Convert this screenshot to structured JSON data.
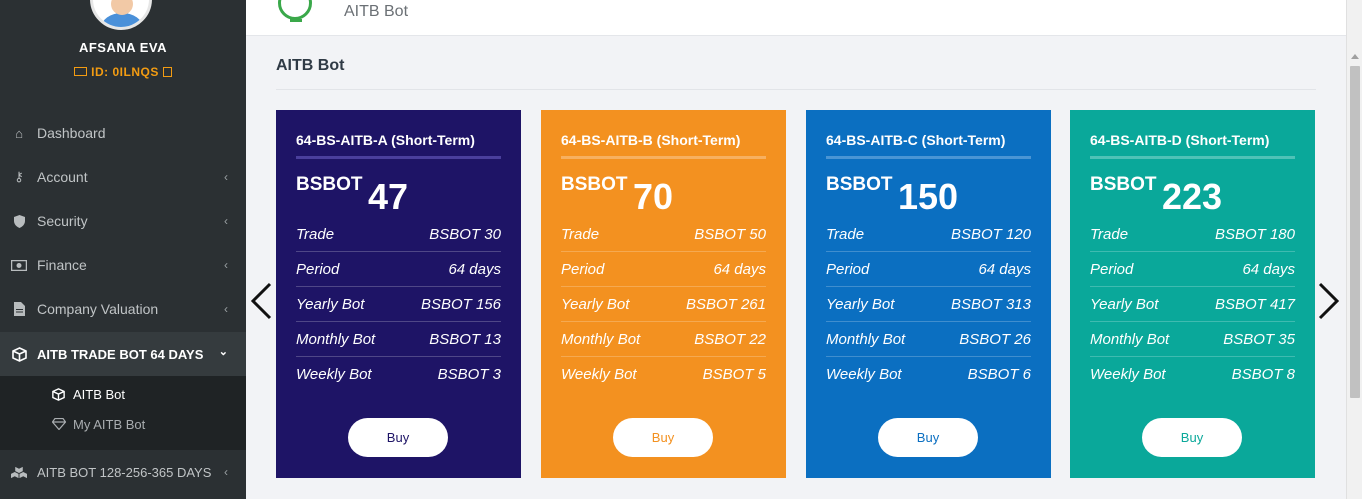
{
  "user": {
    "name": "AFSANA EVA",
    "id_label": "ID: 0ILNQS"
  },
  "sidebar": {
    "items": [
      {
        "label": "Dashboard",
        "icon": "home-icon",
        "chevron": false
      },
      {
        "label": "Account",
        "icon": "key-icon",
        "chevron": true
      },
      {
        "label": "Security",
        "icon": "shield-icon",
        "chevron": true
      },
      {
        "label": "Finance",
        "icon": "money-icon",
        "chevron": true
      },
      {
        "label": "Company Valuation",
        "icon": "file-icon",
        "chevron": true
      },
      {
        "label": "AITB TRADE BOT 64 DAYS",
        "icon": "cube-icon",
        "chevron": true,
        "active": true
      },
      {
        "label": "AITB BOT 128-256-365 DAYS",
        "icon": "cubes-icon",
        "chevron": true
      }
    ],
    "submenu": [
      {
        "label": "AITB Bot",
        "icon": "cube-icon",
        "active": true
      },
      {
        "label": "My AITB Bot",
        "icon": "diamond-icon",
        "active": false
      }
    ]
  },
  "header": {
    "title": "AITB Bot"
  },
  "page": {
    "title": "AITB Bot"
  },
  "cards": [
    {
      "title": "64-BS-AITB-A (Short-Term)",
      "currency": "BSBOT",
      "price": "47",
      "color": "#1e1466",
      "button_color": "#1e1466",
      "rows": [
        {
          "label": "Trade",
          "value": "BSBOT 30"
        },
        {
          "label": "Period",
          "value": "64 days"
        },
        {
          "label": "Yearly Bot",
          "value": "BSBOT 156"
        },
        {
          "label": "Monthly Bot",
          "value": "BSBOT 13"
        },
        {
          "label": "Weekly Bot",
          "value": "BSBOT 3"
        }
      ],
      "button": "Buy"
    },
    {
      "title": "64-BS-AITB-B (Short-Term)",
      "currency": "BSBOT",
      "price": "70",
      "color": "#f39120",
      "button_color": "#f39120",
      "rows": [
        {
          "label": "Trade",
          "value": "BSBOT 50"
        },
        {
          "label": "Period",
          "value": "64 days"
        },
        {
          "label": "Yearly Bot",
          "value": "BSBOT 261"
        },
        {
          "label": "Monthly Bot",
          "value": "BSBOT 22"
        },
        {
          "label": "Weekly Bot",
          "value": "BSBOT 5"
        }
      ],
      "button": "Buy"
    },
    {
      "title": "64-BS-AITB-C (Short-Term)",
      "currency": "BSBOT",
      "price": "150",
      "color": "#0b6fc1",
      "button_color": "#0b6fc1",
      "rows": [
        {
          "label": "Trade",
          "value": "BSBOT 120"
        },
        {
          "label": "Period",
          "value": "64 days"
        },
        {
          "label": "Yearly Bot",
          "value": "BSBOT 313"
        },
        {
          "label": "Monthly Bot",
          "value": "BSBOT 26"
        },
        {
          "label": "Weekly Bot",
          "value": "BSBOT 6"
        }
      ],
      "button": "Buy"
    },
    {
      "title": "64-BS-AITB-D (Short-Term)",
      "currency": "BSBOT",
      "price": "223",
      "color": "#0aa89a",
      "button_color": "#0aa89a",
      "rows": [
        {
          "label": "Trade",
          "value": "BSBOT 180"
        },
        {
          "label": "Period",
          "value": "64 days"
        },
        {
          "label": "Yearly Bot",
          "value": "BSBOT 417"
        },
        {
          "label": "Monthly Bot",
          "value": "BSBOT 35"
        },
        {
          "label": "Weekly Bot",
          "value": "BSBOT 8"
        }
      ],
      "button": "Buy"
    }
  ],
  "carousel": {
    "prev_icon": "chevron-left-icon",
    "next_icon": "chevron-right-icon"
  }
}
